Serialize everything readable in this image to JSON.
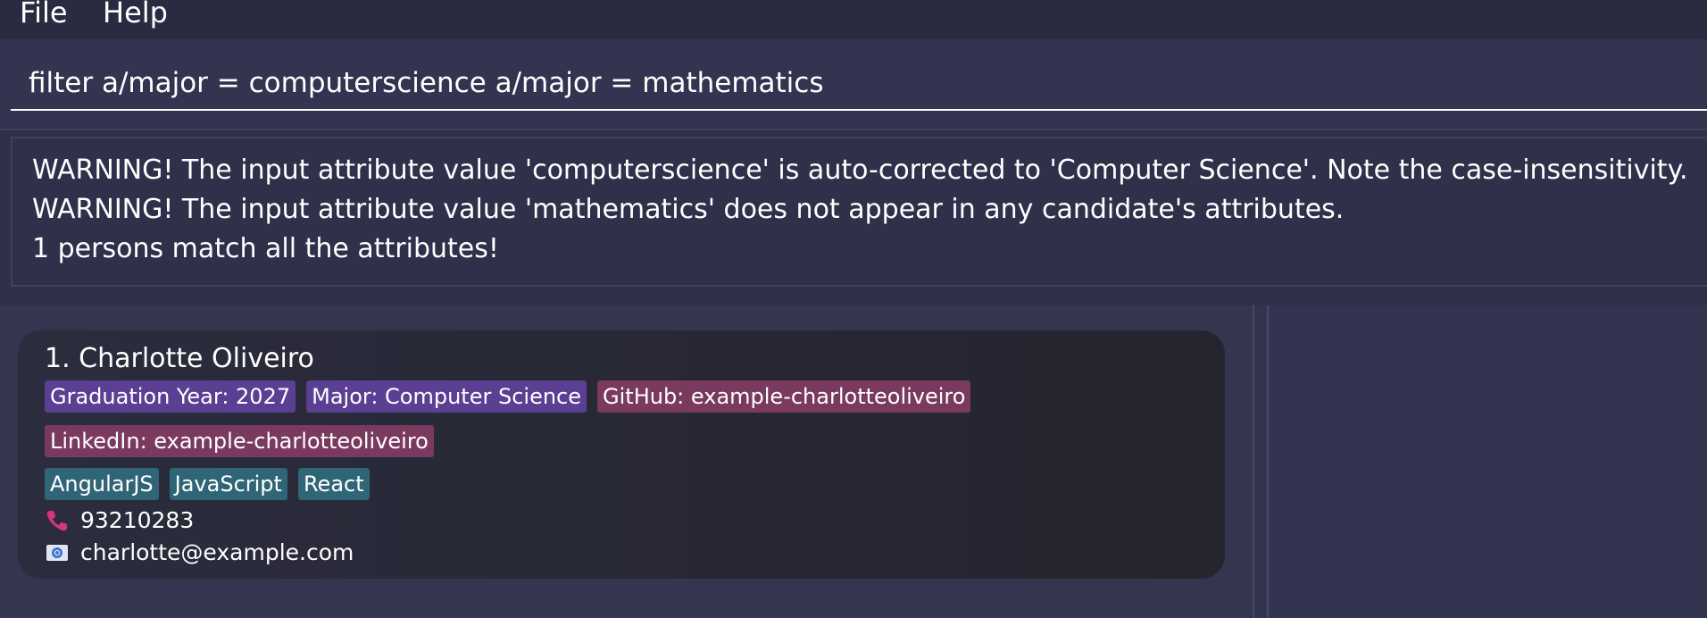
{
  "menubar": {
    "items": [
      {
        "label": "File"
      },
      {
        "label": "Help"
      }
    ]
  },
  "command_box": {
    "value": "filter a/major = computerscience a/major = mathematics"
  },
  "result_display": {
    "lines": [
      "WARNING! The input attribute value 'computerscience' is auto-corrected to 'Computer Science'. Note the case-insensitivity.",
      "WARNING! The input attribute value 'mathematics' does not appear in any candidate's attributes.",
      "1 persons match all the attributes!"
    ]
  },
  "person_list": [
    {
      "name": "1. Charlotte Oliveiro",
      "attribute_tags": [
        {
          "label": "Graduation Year: 2027",
          "color": "#5a3f92"
        },
        {
          "label": "Major: Computer Science",
          "color": "#5a3f92"
        },
        {
          "label": "GitHub: example-charlotteoliveiro",
          "color": "#7a3a5f"
        }
      ],
      "link_tags": [
        {
          "label": "LinkedIn: example-charlotteoliveiro",
          "color": "#7a3a5f"
        }
      ],
      "skill_tags": [
        {
          "label": "AngularJS",
          "color": "#2f6576"
        },
        {
          "label": "JavaScript",
          "color": "#2f6576"
        },
        {
          "label": "React",
          "color": "#2f6576"
        }
      ],
      "phone": {
        "value": "93210283",
        "icon": "phone-icon"
      },
      "email": {
        "value": "charlotte@example.com",
        "icon": "email-icon"
      }
    }
  ]
}
